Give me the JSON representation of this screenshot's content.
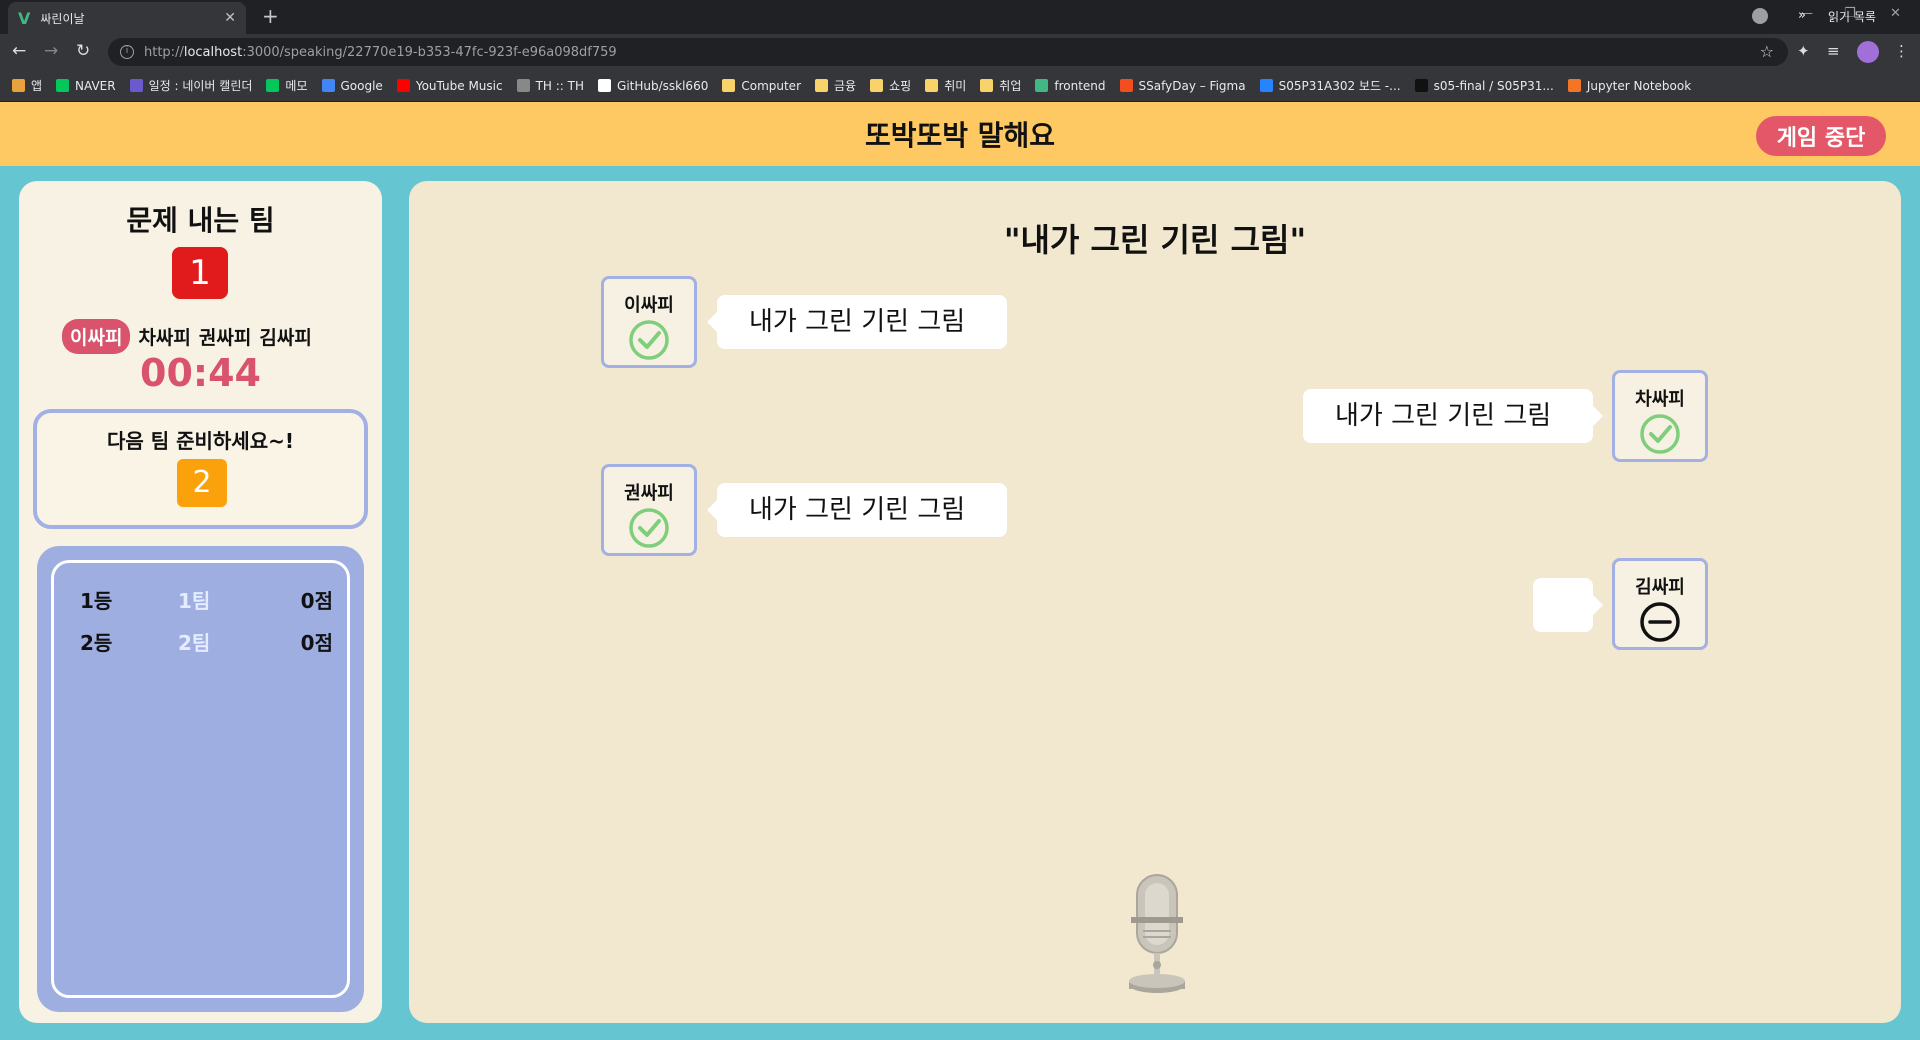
{
  "browser": {
    "tab_title": "싸린이날",
    "url_prefix": "http://",
    "url_host": "localhost",
    "url_rest": ":3000/speaking/22770e19-b353-47fc-923f-e96a098df759",
    "bookmarks": [
      {
        "label": "앱",
        "color": "#e8a33d"
      },
      {
        "label": "NAVER",
        "color": "#03c75a"
      },
      {
        "label": "일정 : 네이버 캘린더",
        "color": "#6a5acd"
      },
      {
        "label": "메모",
        "color": "#03c75a"
      },
      {
        "label": "Google",
        "color": "#4285f4"
      },
      {
        "label": "YouTube Music",
        "color": "#ff0000"
      },
      {
        "label": "TH :: TH",
        "color": "#888888"
      },
      {
        "label": "GitHub/sskl660",
        "color": "#ffffff"
      },
      {
        "label": "Computer",
        "color": "#f9d36a"
      },
      {
        "label": "금융",
        "color": "#f9d36a"
      },
      {
        "label": "쇼핑",
        "color": "#f9d36a"
      },
      {
        "label": "취미",
        "color": "#f9d36a"
      },
      {
        "label": "취업",
        "color": "#f9d36a"
      },
      {
        "label": "frontend",
        "color": "#41b883"
      },
      {
        "label": "SSafyDay – Figma",
        "color": "#f24e1e"
      },
      {
        "label": "S05P31A302 보드 -...",
        "color": "#2684ff"
      },
      {
        "label": "s05-final / S05P31...",
        "color": "#111111"
      },
      {
        "label": "Jupyter Notebook",
        "color": "#f37626"
      }
    ],
    "more_label": "»",
    "reading_list": "읽기 목록"
  },
  "header": {
    "title": "또박또박 말해요",
    "stop_button": "게임 중단"
  },
  "left": {
    "title": "문제 내는 팀",
    "current_team": "1",
    "players": [
      {
        "name": "이싸피",
        "active": true
      },
      {
        "name": "차싸피",
        "active": false
      },
      {
        "name": "권싸피",
        "active": false
      },
      {
        "name": "김싸피",
        "active": false
      }
    ],
    "timer": "00:44",
    "next_text": "다음 팀 준비하세요~!",
    "next_team": "2",
    "scores": [
      {
        "rank": "1등",
        "team": "1팀",
        "points": "0점"
      },
      {
        "rank": "2등",
        "team": "2팀",
        "points": "0점"
      }
    ]
  },
  "main": {
    "word": "\"내가 그린 기린 그림\"",
    "answers": [
      {
        "player": "이싸피",
        "text": "내가 그린 기린 그림",
        "status": "check-icon"
      },
      {
        "player": "차싸피",
        "text": "내가 그린 기린 그림",
        "status": "check-icon"
      },
      {
        "player": "권싸피",
        "text": "내가 그린 기린 그림",
        "status": "check-icon"
      },
      {
        "player": "김싸피",
        "text": "",
        "status": "minus-circle-icon"
      }
    ]
  },
  "colors": {
    "header_bg": "#fec862",
    "page_bg": "#65c6d2",
    "accent_pink": "#d9536d",
    "team_red": "#e11b1b",
    "team_orange": "#fba10b",
    "check_green": "#7fce7c",
    "panel_border": "#a3b0e3"
  }
}
